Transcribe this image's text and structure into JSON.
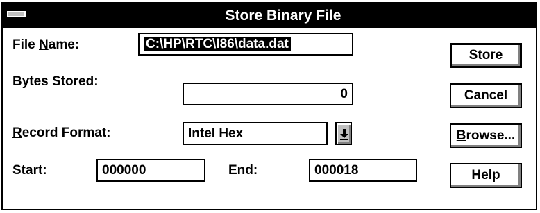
{
  "window": {
    "title": "Store Binary File"
  },
  "form": {
    "file_name_label_pre": "File ",
    "file_name_label_ul": "N",
    "file_name_label_post": "ame:",
    "file_name_value": "C:\\HP\\RTC\\I86\\data.dat",
    "bytes_stored_label": "Bytes Stored:",
    "bytes_stored_value": "0",
    "record_format_label_ul": "R",
    "record_format_label_post": "ecord Format:",
    "record_format_value": "Intel Hex",
    "start_label": "Start:",
    "start_value": "000000",
    "end_label": "End:",
    "end_value": "000018"
  },
  "buttons": {
    "store": "Store",
    "cancel": "Cancel",
    "browse_ul": "B",
    "browse_post": "rowse...",
    "help_ul": "H",
    "help_post": "elp"
  },
  "icons": {
    "system_menu": "system-menu-icon",
    "dropdown": "dropdown-arrow-icon"
  }
}
